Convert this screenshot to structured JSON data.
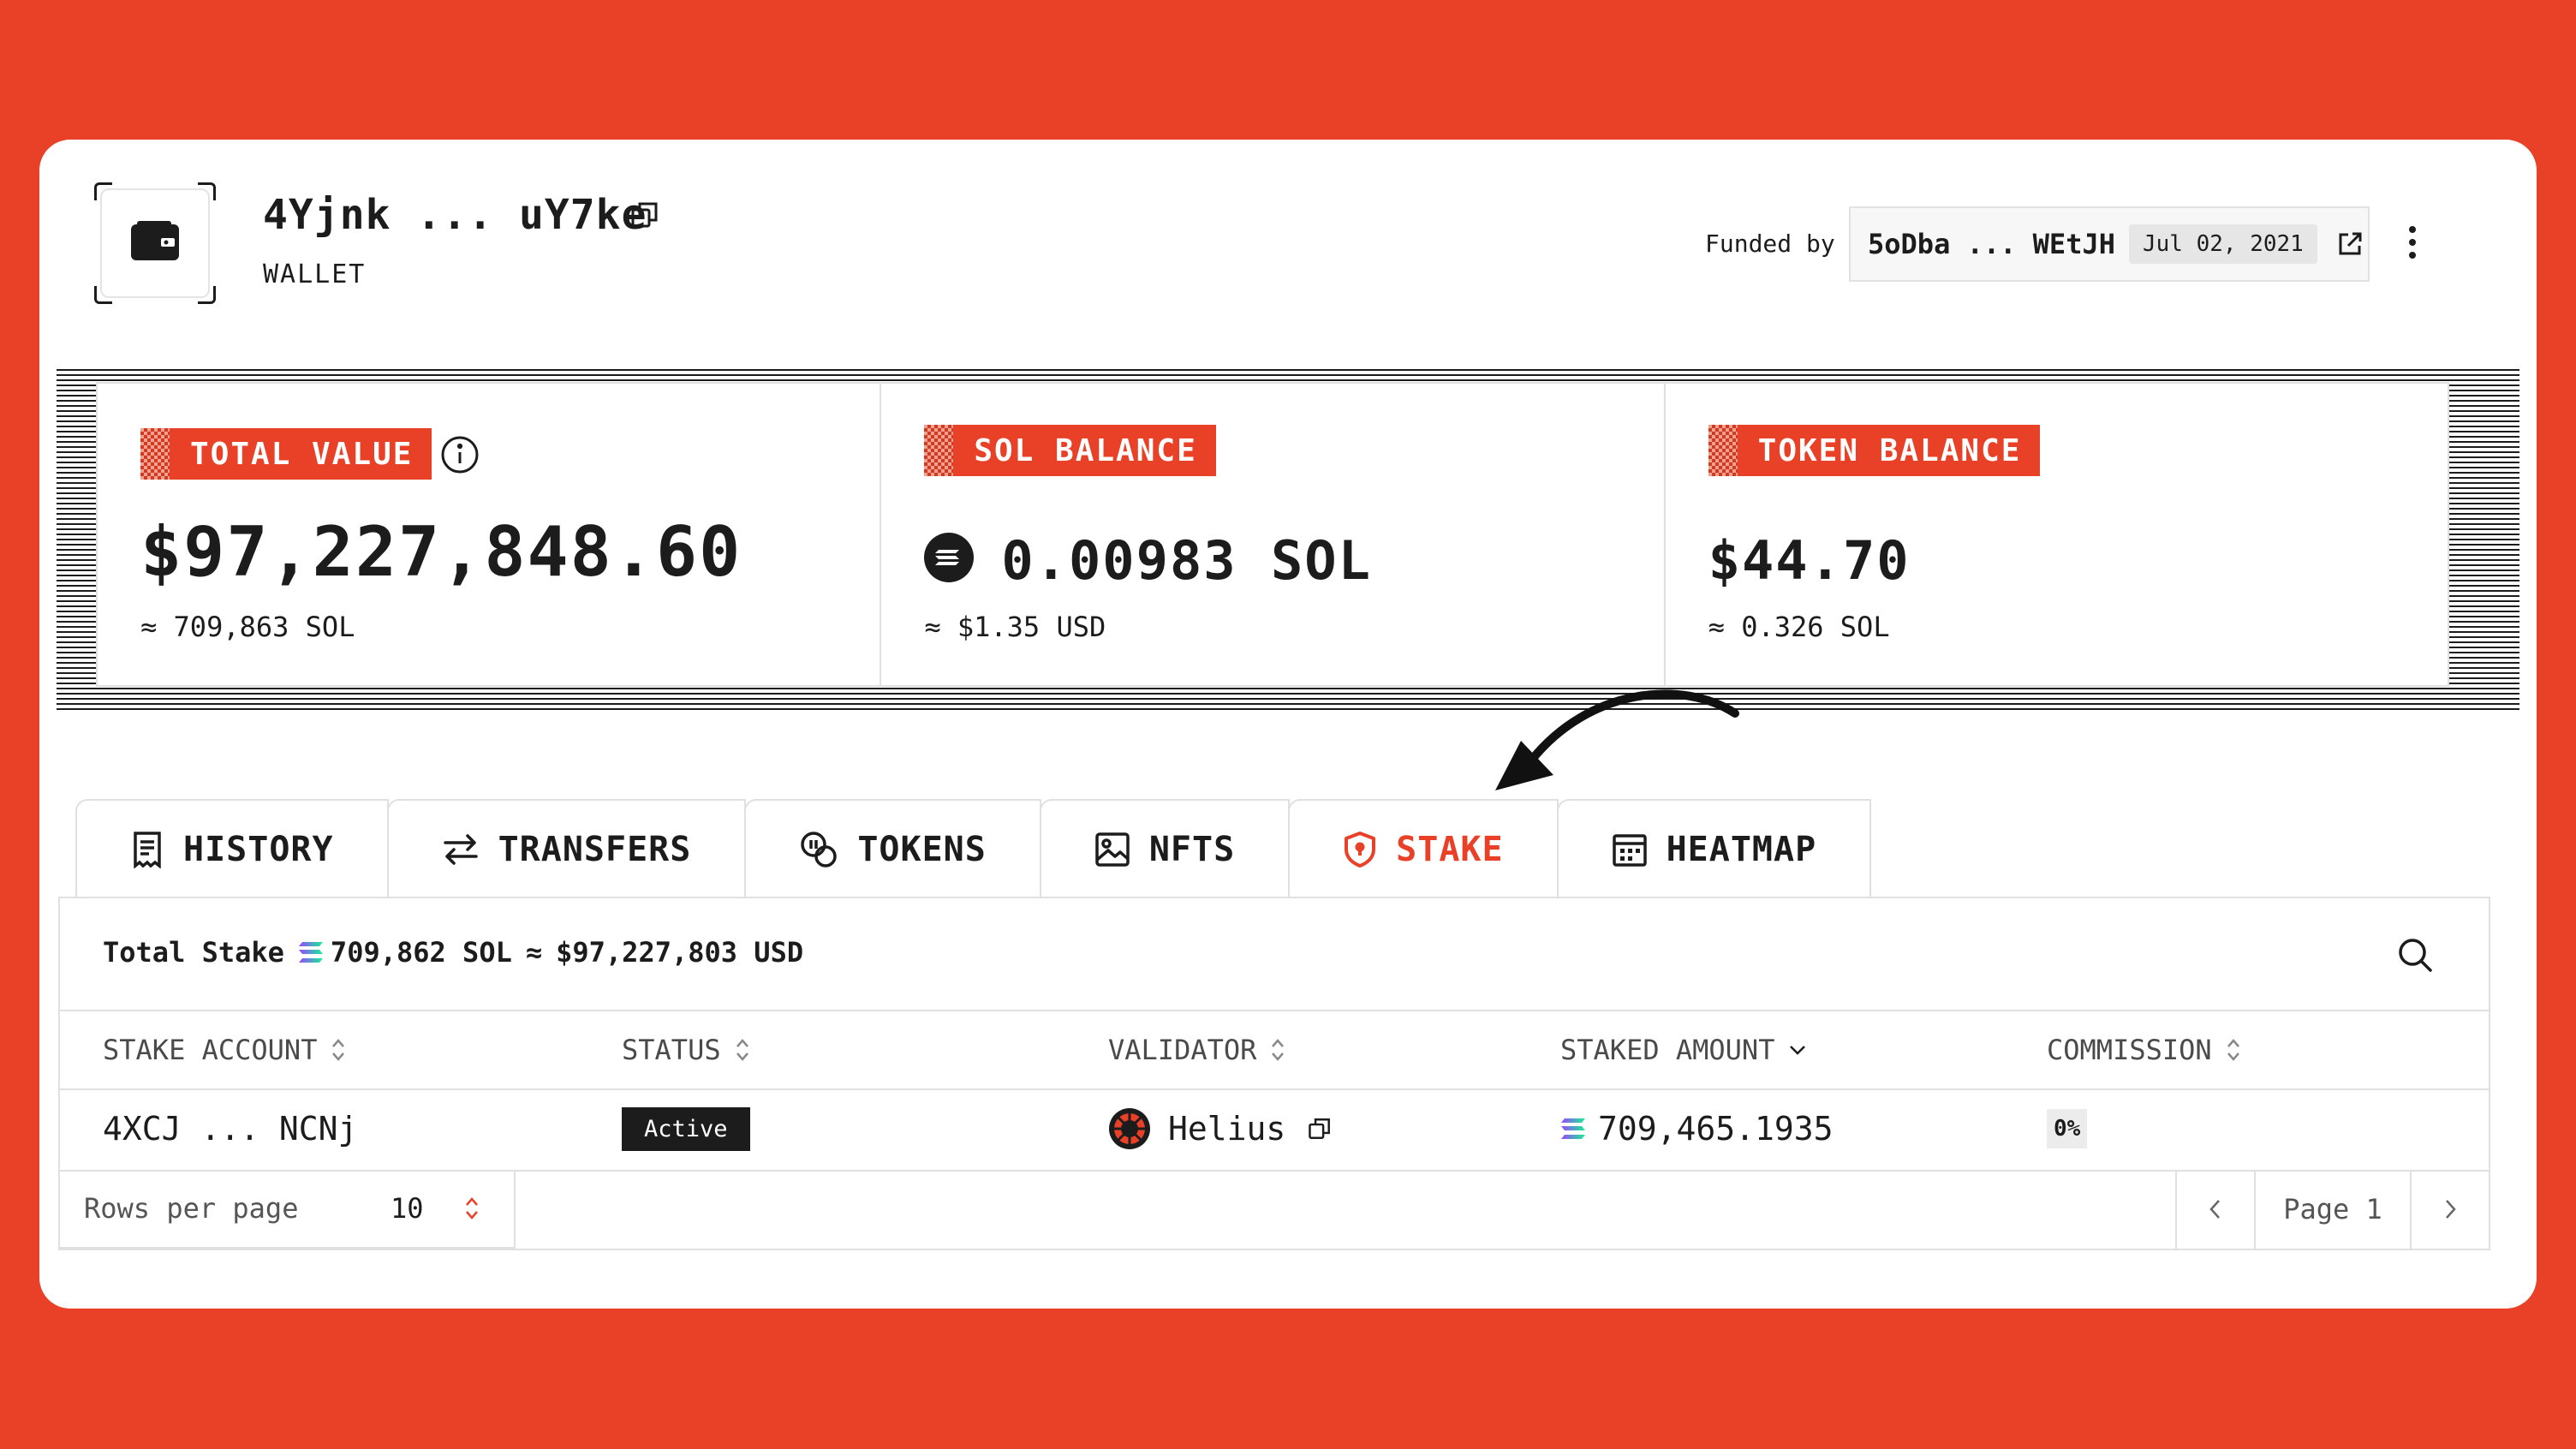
{
  "header": {
    "wallet_address": "4Yjnk ... uY7ke",
    "wallet_type": "WALLET",
    "funded_label": "Funded by",
    "funded_address": "5oDba ... WEtJH",
    "funded_date": "Jul 02, 2021"
  },
  "stats": {
    "total": {
      "label": "TOTAL VALUE",
      "value": "$97,227,848.60",
      "sub": "≈ 709,863 SOL"
    },
    "sol": {
      "label": "SOL BALANCE",
      "value": "0.00983 SOL",
      "sub": "≈ $1.35 USD"
    },
    "token": {
      "label": "TOKEN BALANCE",
      "value": "$44.70",
      "sub": "≈ 0.326 SOL"
    }
  },
  "tabs": [
    {
      "label": "HISTORY",
      "icon": "receipt-icon"
    },
    {
      "label": "TRANSFERS",
      "icon": "transfer-arrows-icon"
    },
    {
      "label": "TOKENS",
      "icon": "coins-icon"
    },
    {
      "label": "NFTS",
      "icon": "image-icon"
    },
    {
      "label": "STAKE",
      "icon": "shield-icon",
      "active": true
    },
    {
      "label": "HEATMAP",
      "icon": "calendar-icon"
    }
  ],
  "stake": {
    "total_label": "Total Stake",
    "total_sol": "709,862 SOL",
    "approx": "≈",
    "total_usd": "$97,227,803 USD",
    "columns": [
      "STAKE ACCOUNT",
      "STATUS",
      "VALIDATOR",
      "STAKED AMOUNT",
      "COMMISSION"
    ],
    "rows": [
      {
        "account": "4XCJ ... NCNj",
        "status": "Active",
        "validator": "Helius",
        "amount": "709,465.1935",
        "commission": "0%"
      }
    ],
    "rows_per_page_label": "Rows per page",
    "rows_per_page": "10",
    "page_label": "Page 1"
  },
  "colors": {
    "accent": "#e84127",
    "dark": "#1c1c1c",
    "border": "#e0e0e0"
  }
}
